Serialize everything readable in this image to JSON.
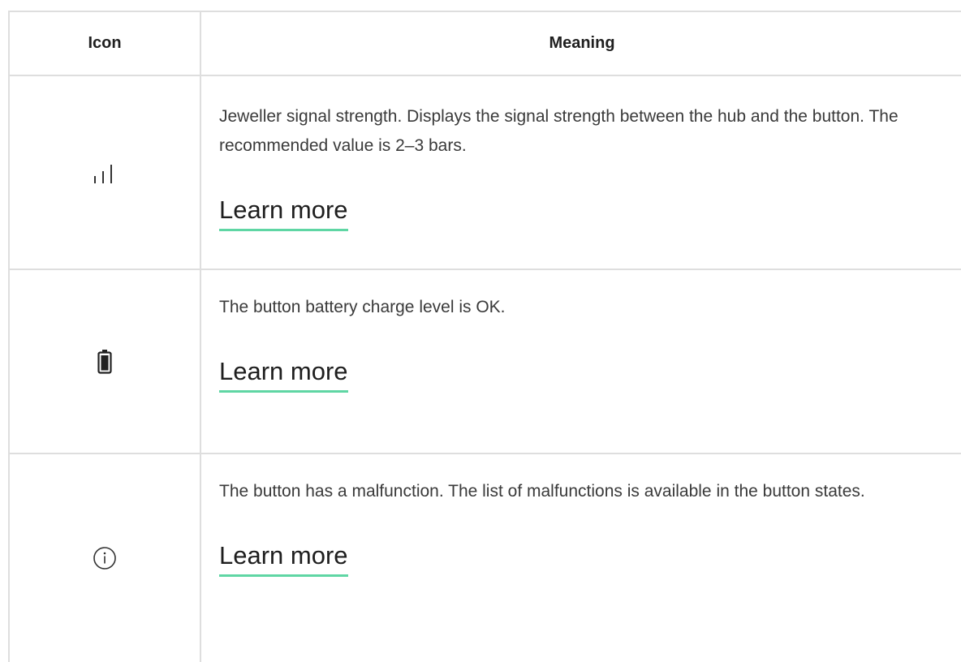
{
  "table": {
    "headers": {
      "icon": "Icon",
      "meaning": "Meaning"
    },
    "rows": [
      {
        "icon": "signal-strength-icon",
        "description": "Jeweller signal strength. Displays the signal strength between the hub and the button. The recommended value is 2–3 bars.",
        "link_label": "Learn more"
      },
      {
        "icon": "battery-icon",
        "description": "The button battery charge level is OK.",
        "link_label": "Learn more"
      },
      {
        "icon": "info-icon",
        "description": "The button has a malfunction. The list of malfunctions is available in the button states.",
        "link_label": "Learn more"
      }
    ]
  },
  "colors": {
    "border": "#dedede",
    "link_underline": "#5fd6a4",
    "text": "#3a3a3a"
  }
}
